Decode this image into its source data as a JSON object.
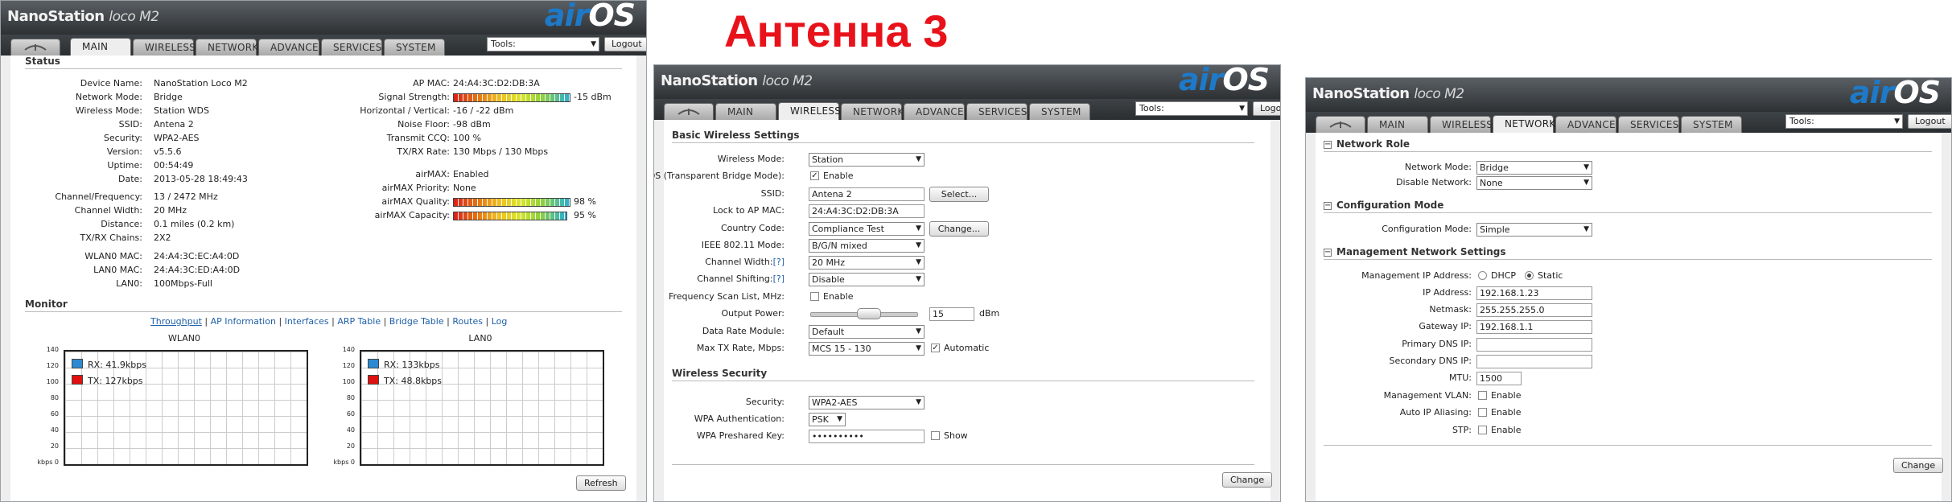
{
  "heading": "Антенна 3",
  "colors": {
    "heading": "#e8121b",
    "link": "#1f5fa8",
    "rx": "#2d8ad2",
    "tx": "#e01010"
  },
  "brand": {
    "name": "NanoStation",
    "model": "loco M2",
    "air": "air",
    "os": "OS"
  },
  "tabs": [
    "MAIN",
    "WIRELESS",
    "NETWORK",
    "ADVANCED",
    "SERVICES",
    "SYSTEM"
  ],
  "tools_label": "Tools:",
  "logout_label": "Logout",
  "main": {
    "status_title": "Status",
    "left": [
      {
        "label": "Device Name:",
        "value": "NanoStation Loco M2"
      },
      {
        "label": "Network Mode:",
        "value": "Bridge"
      },
      {
        "label": "Wireless Mode:",
        "value": "Station WDS"
      },
      {
        "label": "SSID:",
        "value": "Antena 2"
      },
      {
        "label": "Security:",
        "value": "WPA2-AES"
      },
      {
        "label": "Version:",
        "value": "v5.5.6"
      },
      {
        "label": "Uptime:",
        "value": "00:54:49"
      },
      {
        "label": "Date:",
        "value": "2013-05-28 18:49:43"
      },
      {
        "label": "Channel/Frequency:",
        "value": "13 / 2472 MHz"
      },
      {
        "label": "Channel Width:",
        "value": "20 MHz"
      },
      {
        "label": "Distance:",
        "value": "0.1 miles (0.2 km)"
      },
      {
        "label": "TX/RX Chains:",
        "value": "2X2"
      },
      {
        "label": "WLAN0 MAC:",
        "value": "24:A4:3C:EC:A4:0D"
      },
      {
        "label": "LAN0 MAC:",
        "value": "24:A4:3C:ED:A4:0D"
      },
      {
        "label": "LAN0:",
        "value": "100Mbps-Full"
      }
    ],
    "right": [
      {
        "label": "AP MAC:",
        "value": "24:A4:3C:D2:DB:3A"
      },
      {
        "label": "Signal Strength:",
        "value": "-15 dBm"
      },
      {
        "label": "Horizontal / Vertical:",
        "value": "-16 / -22 dBm"
      },
      {
        "label": "Noise Floor:",
        "value": "-98 dBm"
      },
      {
        "label": "Transmit CCQ:",
        "value": "100 %"
      },
      {
        "label": "TX/RX Rate:",
        "value": "130 Mbps / 130 Mbps"
      },
      {
        "label": "airMAX:",
        "value": "Enabled"
      },
      {
        "label": "airMAX Priority:",
        "value": "None"
      },
      {
        "label": "airMAX Quality:",
        "value": "98 %"
      },
      {
        "label": "airMAX Capacity:",
        "value": "95 %"
      }
    ],
    "monitor_title": "Monitor",
    "monitor_links": [
      "Throughput",
      "AP Information",
      "Interfaces",
      "ARP Table",
      "Bridge Table",
      "Routes",
      "Log"
    ],
    "graphs": [
      {
        "title": "WLAN0",
        "rx": "RX: 41.9kbps",
        "tx": "TX: 127kbps"
      },
      {
        "title": "LAN0",
        "rx": "RX: 133kbps",
        "tx": "TX: 48.8kbps"
      }
    ],
    "yticks": [
      "140",
      "120",
      "100",
      "80",
      "60",
      "40",
      "20",
      "kbps 0"
    ],
    "refresh_label": "Refresh"
  },
  "wireless": {
    "basic_title": "Basic Wireless Settings",
    "wireless_mode_label": "Wireless Mode:",
    "wireless_mode": "Station",
    "wds_label": "WDS (Transparent Bridge Mode):",
    "wds_enable": "Enable",
    "ssid_label": "SSID:",
    "ssid": "Antena 2",
    "select_label": "Select...",
    "lock_label": "Lock to AP MAC:",
    "lock": "24:A4:3C:D2:DB:3A",
    "country_label": "Country Code:",
    "country": "Compliance Test",
    "change_label": "Change...",
    "ieee_label": "IEEE 802.11 Mode:",
    "ieee": "B/G/N mixed",
    "chwidth_label": "Channel Width:",
    "chwidth": "20 MHz",
    "chshift_label": "Channel Shifting:",
    "chshift": "Disable",
    "help_tag": "[?]",
    "fscan_label": "Frequency Scan List, MHz:",
    "fscan_enable": "Enable",
    "power_label": "Output Power:",
    "power": "15",
    "power_unit": "dBm",
    "drm_label": "Data Rate Module:",
    "drm": "Default",
    "maxtx_label": "Max TX Rate, Mbps:",
    "maxtx": "MCS 15 - 130",
    "automatic": "Automatic",
    "security_title": "Wireless Security",
    "security_label": "Security:",
    "security": "WPA2-AES",
    "wpaauth_label": "WPA Authentication:",
    "wpaauth": "PSK",
    "wpakey_label": "WPA Preshared Key:",
    "wpakey": "••••••••••",
    "show": "Show",
    "change_button": "Change"
  },
  "network": {
    "role_title": "Network Role",
    "netmode_label": "Network Mode:",
    "netmode": "Bridge",
    "disnet_label": "Disable Network:",
    "disnet": "None",
    "config_title": "Configuration Mode",
    "configmode_label": "Configuration Mode:",
    "configmode": "Simple",
    "mgmt_title": "Management Network Settings",
    "mgmtip_label": "Management IP Address:",
    "dhcp": "DHCP",
    "static": "Static",
    "ip_label": "IP Address:",
    "ip": "192.168.1.23",
    "netmask_label": "Netmask:",
    "netmask": "255.255.255.0",
    "gateway_label": "Gateway IP:",
    "gateway": "192.168.1.1",
    "pdns_label": "Primary DNS IP:",
    "pdns": "",
    "sdns_label": "Secondary DNS IP:",
    "sdns": "",
    "mtu_label": "MTU:",
    "mtu": "1500",
    "mvlan_label": "Management VLAN:",
    "aipa_label": "Auto IP Aliasing:",
    "stp_label": "STP:",
    "enable": "Enable",
    "change_button": "Change"
  }
}
